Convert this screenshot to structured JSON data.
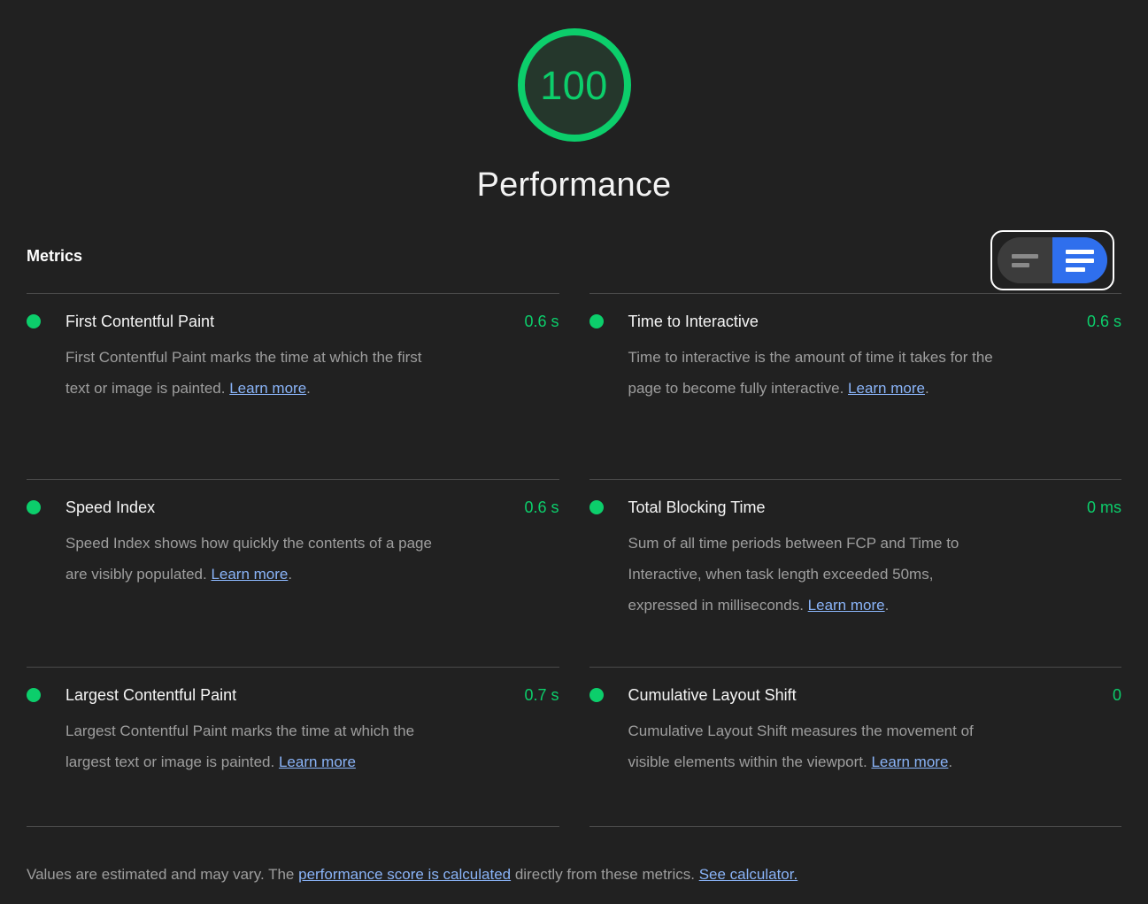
{
  "colors": {
    "background": "#212121",
    "pass_green": "#0cce6b",
    "gauge_fill": "#25372c",
    "link_blue": "#8ab4f8",
    "toggle_active_blue": "#2f6fed",
    "text_primary": "#f5f5f5",
    "text_secondary": "#9e9e9e",
    "divider": "#4a4a4a"
  },
  "gauge": {
    "score": "100",
    "category_title": "Performance"
  },
  "section": {
    "heading": "Metrics",
    "toggle": {
      "left_option_label": "Collapsed view",
      "left_icon": "list-collapsed-icon",
      "right_option_label": "Expanded view",
      "right_icon": "list-expanded-icon",
      "selected": "right",
      "focused": true
    }
  },
  "metrics": [
    {
      "name": "First Contentful Paint",
      "value": "0.6 s",
      "status": "pass",
      "desc_before": "First Contentful Paint marks the time at which the first text or image is painted. ",
      "link_text": "Learn more",
      "desc_after": "."
    },
    {
      "name": "Time to Interactive",
      "value": "0.6 s",
      "status": "pass",
      "desc_before": "Time to interactive is the amount of time it takes for the page to become fully interactive. ",
      "link_text": "Learn more",
      "desc_after": "."
    },
    {
      "name": "Speed Index",
      "value": "0.6 s",
      "status": "pass",
      "desc_before": "Speed Index shows how quickly the contents of a page are visibly populated. ",
      "link_text": "Learn more",
      "desc_after": "."
    },
    {
      "name": "Total Blocking Time",
      "value": "0 ms",
      "status": "pass",
      "desc_before": "Sum of all time periods between FCP and Time to Interactive, when task length exceeded 50ms, expressed in milliseconds. ",
      "link_text": "Learn more",
      "desc_after": "."
    },
    {
      "name": "Largest Contentful Paint",
      "value": "0.7 s",
      "status": "pass",
      "desc_before": "Largest Contentful Paint marks the time at which the largest text or image is painted. ",
      "link_text": "Learn more",
      "desc_after": ""
    },
    {
      "name": "Cumulative Layout Shift",
      "value": "0",
      "status": "pass",
      "desc_before": "Cumulative Layout Shift measures the movement of visible elements within the viewport. ",
      "link_text": "Learn more",
      "desc_after": "."
    }
  ],
  "footer": {
    "text_1": "Values are estimated and may vary. The ",
    "link_1": "performance score is calculated",
    "text_2": " directly from these metrics. ",
    "link_2": "See calculator."
  }
}
